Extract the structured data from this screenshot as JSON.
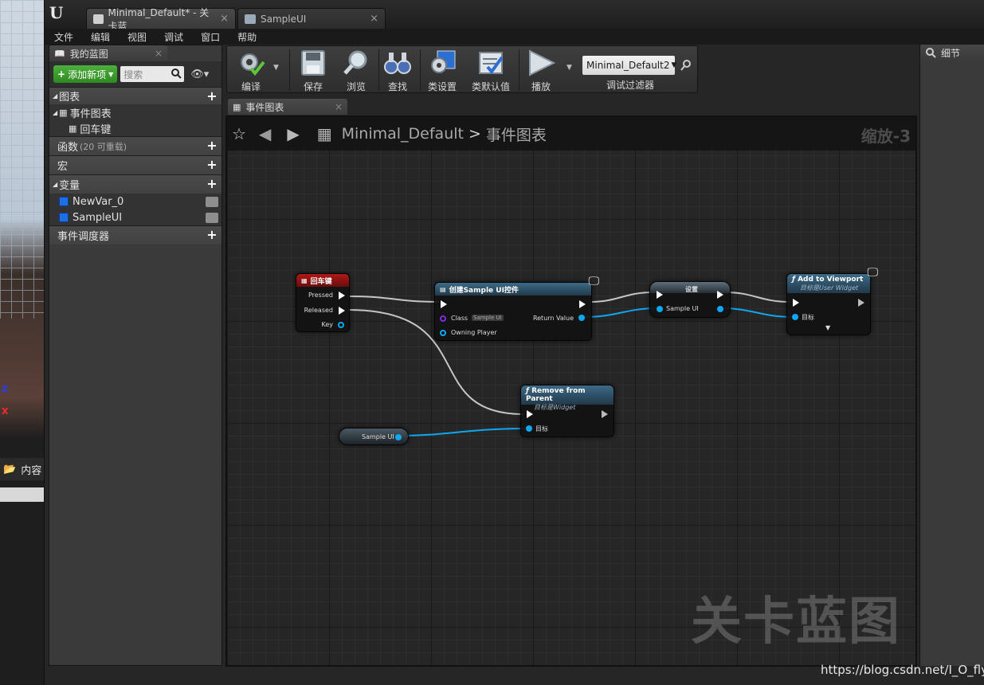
{
  "app": {
    "doc_tabs": [
      {
        "label": "Minimal_Default* - 关卡蓝"
      },
      {
        "label": "SampleUI"
      }
    ],
    "menu": [
      "文件",
      "编辑",
      "视图",
      "调试",
      "窗口",
      "帮助"
    ]
  },
  "background_viewport": {
    "axis_z": "Z",
    "axis_x": "X",
    "content_label": "内容"
  },
  "my_blueprint": {
    "tab_label": "我的蓝图",
    "add_new_label": "添加新项",
    "search_placeholder": "搜索",
    "sections": {
      "graphs": "图表",
      "event_graph": "事件图表",
      "enter_key": "回车键",
      "functions": "函数",
      "functions_count": "(20 可重载)",
      "macros": "宏",
      "variables": "变量",
      "var1": "NewVar_0",
      "var2": "SampleUI",
      "dispatchers": "事件调度器"
    }
  },
  "toolbar": {
    "compile": "编译",
    "save": "保存",
    "browse": "浏览",
    "find": "查找",
    "class_settings": "类设置",
    "class_defaults": "类默认值",
    "play": "播放",
    "debug_object": "Minimal_Default2",
    "debug_filter": "调试过滤器"
  },
  "details": {
    "tab_label": "细节"
  },
  "graph": {
    "tab_label": "事件图表",
    "breadcrumb_root": "Minimal_Default",
    "breadcrumb_sep": ">",
    "breadcrumb_leaf": "事件图表",
    "zoom": "缩放-3",
    "watermark": "关卡蓝图"
  },
  "nodes": {
    "enter": {
      "title": "回车键",
      "pressed": "Pressed",
      "released": "Released",
      "key": "Key"
    },
    "create_widget": {
      "title": "创建Sample UI控件",
      "class_label": "Class",
      "class_value": "Sample UI",
      "owning_player": "Owning Player",
      "return_value": "Return Value"
    },
    "set": {
      "title": "设置",
      "pin": "Sample UI"
    },
    "add_viewport": {
      "title": "Add to Viewport",
      "subtitle": "目标是User Widget",
      "target": "目标"
    },
    "remove": {
      "title": "Remove from Parent",
      "subtitle": "目标是Widget",
      "target": "目标"
    },
    "getter": {
      "label": "Sample UI"
    }
  },
  "watermark_url": "https://blog.csdn.net/I_O_fly",
  "colors": {
    "event_header": "#a81414",
    "function_header": "#2e5a73",
    "object_pin": "#0fa6f2",
    "add_button": "#3c9e2e"
  }
}
